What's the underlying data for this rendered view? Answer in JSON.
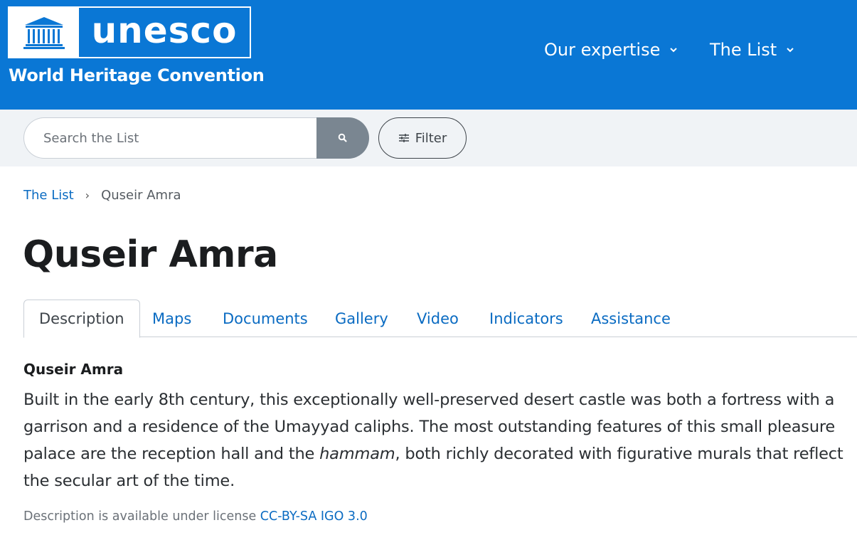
{
  "header": {
    "logo_text": "unesco",
    "emblem_text": "UNESCO",
    "subtitle": "World Heritage Convention",
    "nav": [
      {
        "label": "Our expertise"
      },
      {
        "label": "The List"
      }
    ],
    "background_color": "#0a77d5"
  },
  "search": {
    "placeholder": "Search the List",
    "filter_label": "Filter"
  },
  "breadcrumb": {
    "parent": "The List",
    "current": "Quseir Amra"
  },
  "page": {
    "title": "Quseir Amra"
  },
  "tabs": [
    {
      "label": "Description",
      "active": true
    },
    {
      "label": "Maps"
    },
    {
      "label": "Documents"
    },
    {
      "label": "Gallery"
    },
    {
      "label": "Video"
    },
    {
      "label": "Indicators"
    },
    {
      "label": "Assistance"
    }
  ],
  "content": {
    "section_title": "Quseir Amra",
    "description_part1": "Built in the early 8th century, this exceptionally well-preserved desert castle was both a fortress with a garrison and a residence of the Umayyad caliphs. The most outstanding features of this small pleasure palace are the reception hall and the ",
    "description_italic": "hammam",
    "description_part2": ", both richly decorated with figurative murals that reflect the secular art of the time.",
    "license_prefix": "Description is available under license ",
    "license_link": "CC-BY-SA IGO 3.0"
  },
  "colors": {
    "link": "#0a6bc2",
    "search_button": "#7a8691"
  }
}
